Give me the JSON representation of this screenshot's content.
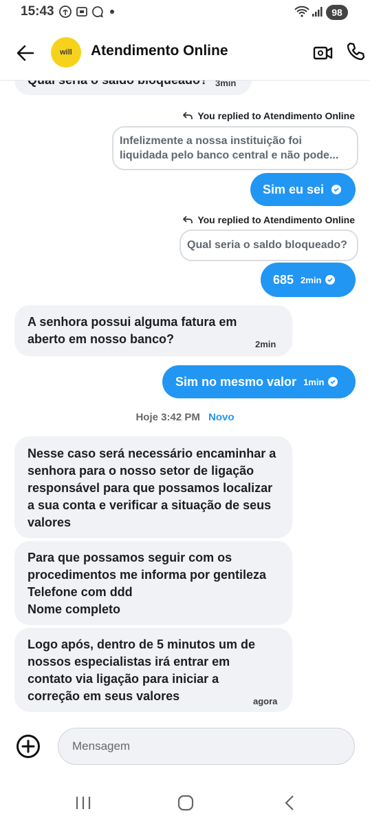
{
  "status_bar": {
    "time": "15:43",
    "battery": "98"
  },
  "header": {
    "title": "Atendimento Online",
    "avatar_text": "will"
  },
  "messages": {
    "top_partial": {
      "text": "Qual seria o saldo bloqueado?",
      "time": "3min"
    },
    "reply1": {
      "replied_label": "You replied to Atendimento Online",
      "quote_line1": "Infelizmente a nossa instituição foi",
      "quote_line2": "liquidada pelo banco central e não pode...",
      "text": "Sim eu sei"
    },
    "reply2": {
      "replied_label": "You replied to Atendimento Online",
      "quote": "Qual seria o saldo bloqueado?",
      "text": "685",
      "time": "2min"
    },
    "in1": {
      "line1": "A senhora possui alguma fatura em",
      "line2": "aberto em nosso banco?",
      "time": "2min"
    },
    "out3": {
      "text": "Sim no mesmo valor",
      "time": "1min"
    },
    "date_separator": {
      "label": "Hoje 3:42 PM",
      "new_label": "Novo"
    },
    "in2": {
      "lines": [
        "Nesse caso será necessário encaminhar a",
        "senhora para o nosso setor de ligação",
        "responsável para que possamos localizar",
        "a sua conta e verificar a situação de seus",
        "valores"
      ]
    },
    "in3": {
      "lines": [
        "Para que possamos seguir com os",
        "procedimentos me informa por gentileza",
        "Telefone com ddd",
        "Nome completo"
      ]
    },
    "in4": {
      "lines": [
        "Logo após, dentro de 5 minutos um de",
        "nossos especialistas irá entrar em",
        "contato via ligação para iniciar a",
        "correção em seus valores"
      ],
      "time": "agora"
    }
  },
  "composer": {
    "placeholder": "Mensagem"
  },
  "icons": {
    "back": "arrow-left-icon",
    "video": "video-camera-icon",
    "call": "phone-icon",
    "plus": "plus-circle-icon",
    "reply": "reply-arrow-icon",
    "check": "check-circle-icon",
    "nav_recent": "recent-apps-icon",
    "nav_home": "home-icon",
    "nav_back": "nav-back-icon"
  },
  "colors": {
    "accent": "#2196f3",
    "incoming_bubble": "#f0f2f5",
    "avatar": "#f6d21c"
  }
}
